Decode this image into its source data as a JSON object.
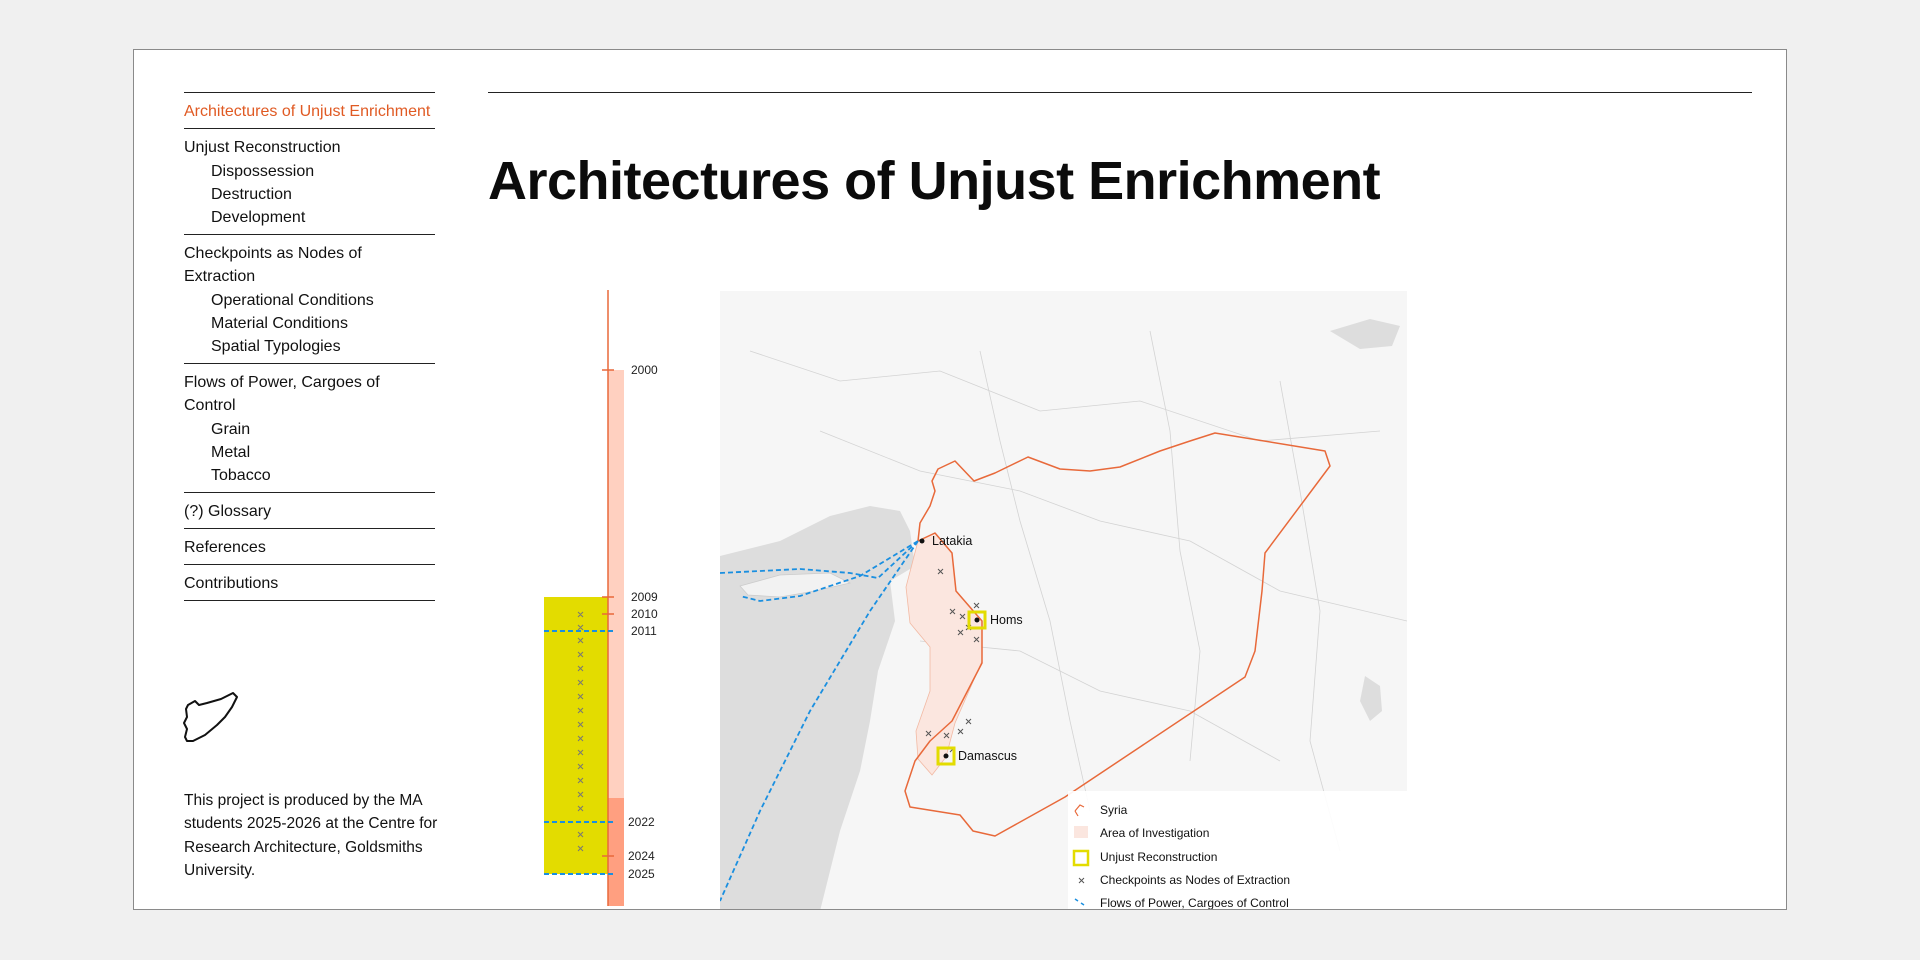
{
  "nav": {
    "sections": [
      {
        "label": "Architectures of Unjust Enrichment",
        "active": true,
        "children": []
      },
      {
        "label": "Unjust Reconstruction",
        "children": [
          "Dispossession",
          "Destruction",
          "Development"
        ]
      },
      {
        "label": "Checkpoints as Nodes of Extraction",
        "children": [
          "Operational Conditions",
          "Material Conditions",
          "Spatial Typologies"
        ]
      },
      {
        "label": "Flows of Power, Cargoes of Control",
        "children": [
          "Grain",
          "Metal",
          "Tobacco"
        ]
      },
      {
        "label": "(?) Glossary",
        "children": []
      },
      {
        "label": "References",
        "children": []
      },
      {
        "label": "Contributions",
        "children": []
      }
    ]
  },
  "credits": "This project is produced by the MA students 2025-2026 at the Centre for Research Architecture, Goldsmiths University.",
  "page": {
    "title": "Architectures of Unjust Enrichment"
  },
  "timeline": {
    "years": [
      "2000",
      "2009",
      "2010",
      "2011",
      "2022",
      "2024",
      "2025"
    ],
    "colors": {
      "axis": "#e8693a",
      "pale": "#ffd0c0",
      "deep": "#ff9f80",
      "highlight": "#e3dc00",
      "flow": "#1a8fe0"
    }
  },
  "map": {
    "cities": [
      "Latakia",
      "Homs",
      "Damascus"
    ],
    "legend": [
      {
        "icon": "syria-border-icon",
        "label": "Syria"
      },
      {
        "icon": "hatch-area-icon",
        "label": "Area of Investigation"
      },
      {
        "icon": "yellow-square-icon",
        "label": "Unjust Reconstruction"
      },
      {
        "icon": "cross-icon",
        "label": "Checkpoints as Nodes of Extraction"
      },
      {
        "icon": "dashed-line-icon",
        "label": "Flows of Power, Cargoes of Control"
      }
    ]
  }
}
